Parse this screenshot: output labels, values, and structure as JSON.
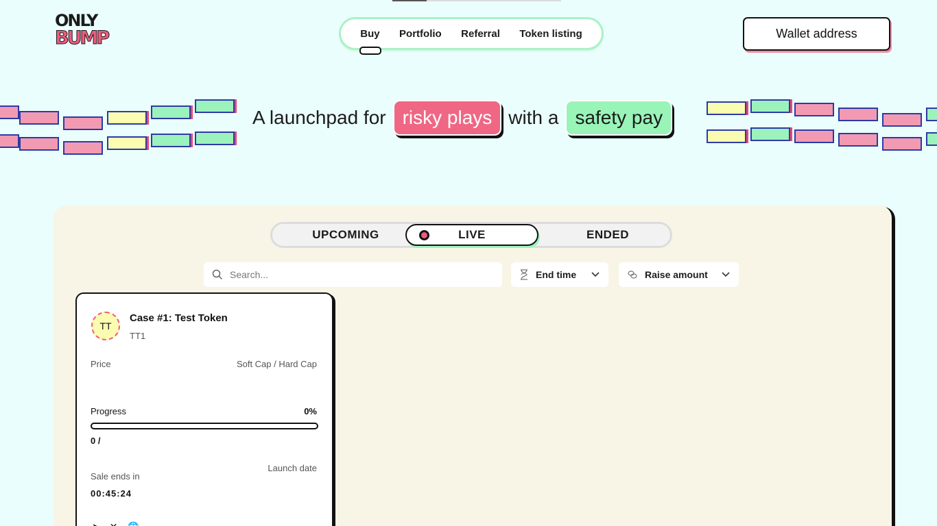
{
  "app": {
    "logo_text_line1": "ONLY",
    "logo_text_line2": "BUMP"
  },
  "nav": {
    "items": [
      {
        "label": "Buy",
        "active": true
      },
      {
        "label": "Portfolio"
      },
      {
        "label": "Referral"
      },
      {
        "label": "Token listing"
      }
    ]
  },
  "wallet": {
    "label": "Wallet address"
  },
  "hero": {
    "prefix": "A launchpad for",
    "pill1": "risky plays",
    "middle": "with a",
    "pill2": "safety pay"
  },
  "tabs": [
    {
      "label": "UPCOMING"
    },
    {
      "label": "LIVE",
      "active": true
    },
    {
      "label": "ENDED"
    }
  ],
  "filters": {
    "search_placeholder": "Search...",
    "end_time_label": "End time",
    "raise_amount_label": "Raise amount"
  },
  "card": {
    "avatar_initials": "TT",
    "title": "Case #1: Test Token",
    "symbol": "TT1",
    "price_label": "Price",
    "cap_label": "Soft Cap / Hard Cap",
    "progress_label": "Progress",
    "progress_value": "0%",
    "progress_fraction": 0,
    "raised": "0 /",
    "sale_ends_label": "Sale ends in",
    "sale_ends_value": "00:45:24",
    "launch_date_label": "Launch date"
  },
  "colors": {
    "accent_pink": "#ee5b7e",
    "accent_green": "#9cf2bc",
    "accent_yellow": "#fafcb1",
    "background": "#eafefd",
    "panel": "#f8f5e6"
  }
}
